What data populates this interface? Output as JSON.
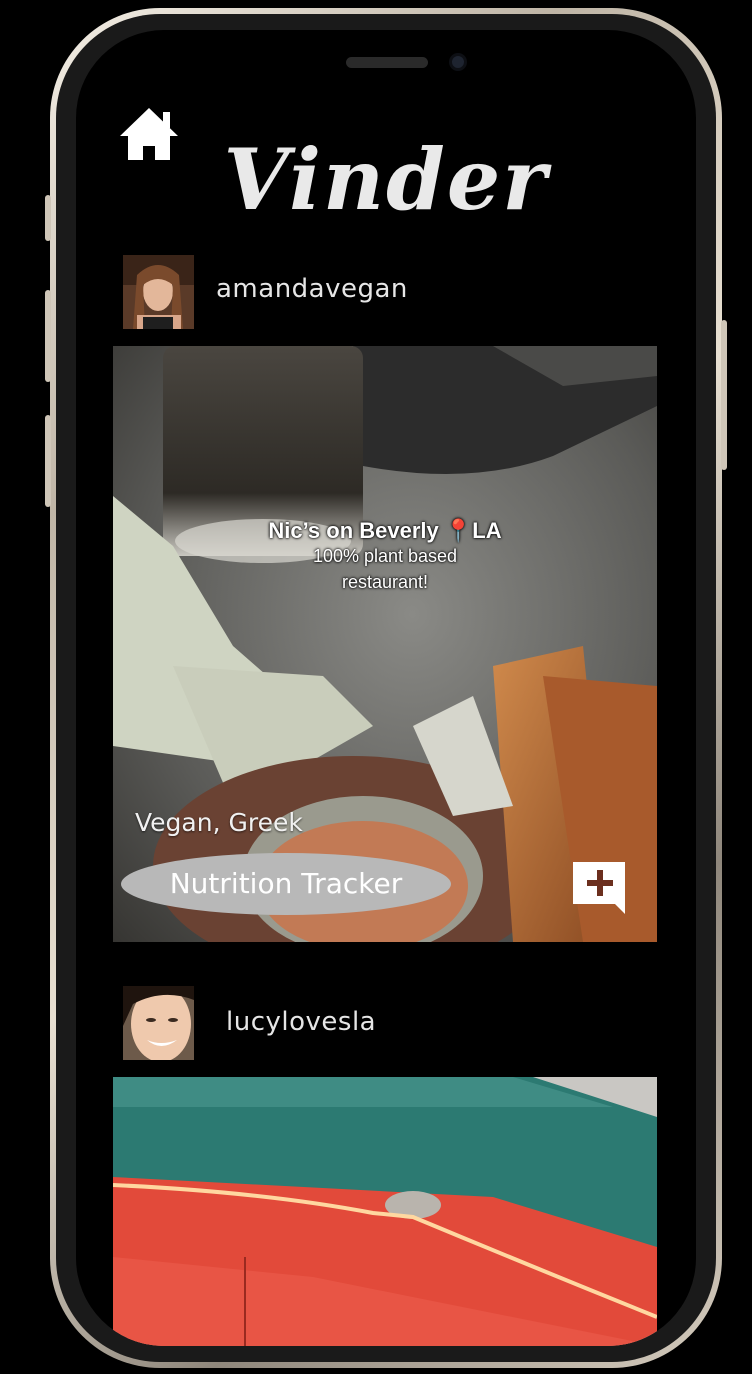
{
  "app": {
    "title": "Vinder"
  },
  "nav": {
    "home_icon": "home-icon"
  },
  "posts": [
    {
      "username": "amandavegan",
      "caption_title": "Nic’s on Beverly 📍LA",
      "caption_line1": "100% plant based",
      "caption_line2": "restaurant!",
      "tags": "Vegan, Greek",
      "nutrition_label": "Nutrition Tracker",
      "add_icon": "add-comment-icon"
    },
    {
      "username": "lucylovesla"
    }
  ],
  "colors": {
    "background": "#000000",
    "text": "#e6e6e6",
    "button": "#b8b8b8",
    "add_button_plus": "#6b2f1e"
  }
}
